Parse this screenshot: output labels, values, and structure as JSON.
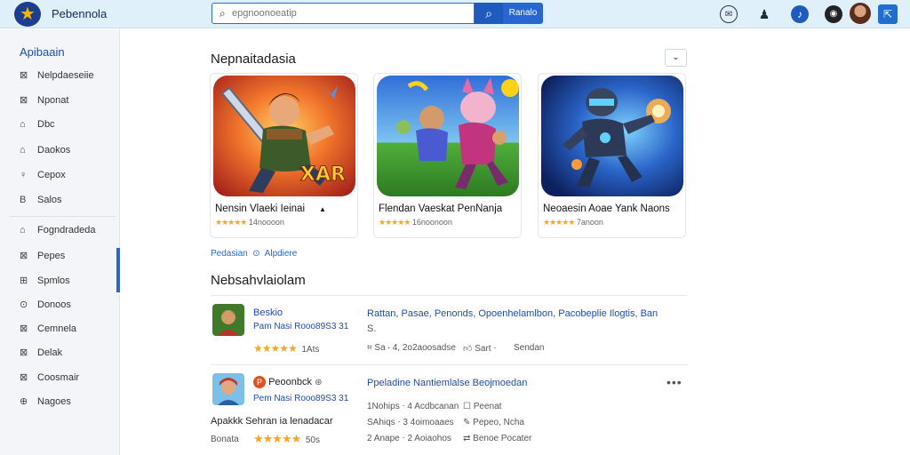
{
  "header": {
    "app_title": "Pebennola",
    "search_placeholder": "epgnoonoeatip",
    "search_button_label": "Ranalo"
  },
  "sidebar": {
    "heading": "Apibaain",
    "items": [
      {
        "icon": "⊠",
        "label": "Nelpdaeseiie"
      },
      {
        "icon": "⊠",
        "label": "Nponat"
      },
      {
        "icon": "⌂",
        "label": "Dbc"
      },
      {
        "icon": "⌂",
        "label": "Daokos"
      },
      {
        "icon": "♀",
        "label": "Cepox"
      },
      {
        "icon": "B",
        "label": "Salos"
      },
      {
        "icon": "⌂",
        "label": "Fogndradeda"
      },
      {
        "icon": "⊠",
        "label": "Pepes"
      },
      {
        "icon": "⊞",
        "label": "Spmlos"
      },
      {
        "icon": "⊙",
        "label": "Donoos"
      },
      {
        "icon": "⊠",
        "label": "Cemnela"
      },
      {
        "icon": "⊠",
        "label": "Delak"
      },
      {
        "icon": "⊠",
        "label": "Coosmair"
      },
      {
        "icon": "⊕",
        "label": "Nagoes"
      }
    ]
  },
  "featured": {
    "title": "Nepnaitadasia",
    "collapse_icon": "chevron-down",
    "cards": [
      {
        "name": "Nensin Vlaeki Ieinai",
        "extra": "▲",
        "rating_stars": "★★★★★",
        "rating_value": 4.5,
        "meta": "14noooon"
      },
      {
        "name": "Flendan Vaeskat PenNanja",
        "extra": "",
        "rating_stars": "★★★★★",
        "rating_value": 4.5,
        "meta": "16noonoon"
      },
      {
        "name": "Neoaesin Aoae Yank Naons",
        "extra": "",
        "rating_stars": "★★★★★",
        "rating_value": 4.5,
        "meta": "7anoon"
      }
    ]
  },
  "breadcrumb": {
    "first": "Pedasian",
    "sep": "⊙",
    "second": "Alpdiere"
  },
  "list_section": {
    "title": "Nebsahvlaiolam",
    "rows": [
      {
        "title": "Beskio",
        "subtitle": "Pam Nasi Rooo89S3 31",
        "rating_stars": "★★★★★",
        "rating_value": 5,
        "rating_count": "1Ats",
        "desc_line1": "Rattan, Pasae, Penonds,  Opoenhelamlbon, Pacobeplie Ilogtis, Ban",
        "desc_line2": "S.",
        "stats": [
          {
            "icon": "bookmark",
            "text": "Sa ⋅ 4, 2o2aoosadse"
          },
          {
            "icon": "thumb-up",
            "text": "Sart ⋅"
          },
          {
            "icon": "",
            "text": "Sendan"
          }
        ]
      },
      {
        "title": "Peoonbck",
        "title_suffix": "⊛",
        "subtitle": "Pem Nasi Rooo89S3 31",
        "left_line": "Apakkk Sehran ia lenadacar",
        "left_label": "Bonata",
        "rating_stars": "★★★★★",
        "rating_value": 5,
        "rating_count": "50s",
        "desc_title": "Ppeladine Nantiemlalse Beojmoedan",
        "stat_left": [
          "1Nohips ⋅ 4 Acdbcanan",
          "SAhiqs ⋅ 3 4oimoaaes",
          "2 Anape ⋅ 2 Aoiaohos"
        ],
        "stat_right": [
          "Peenat",
          "Pepeo, Ncha",
          "Benoe  Pocater"
        ]
      }
    ]
  }
}
